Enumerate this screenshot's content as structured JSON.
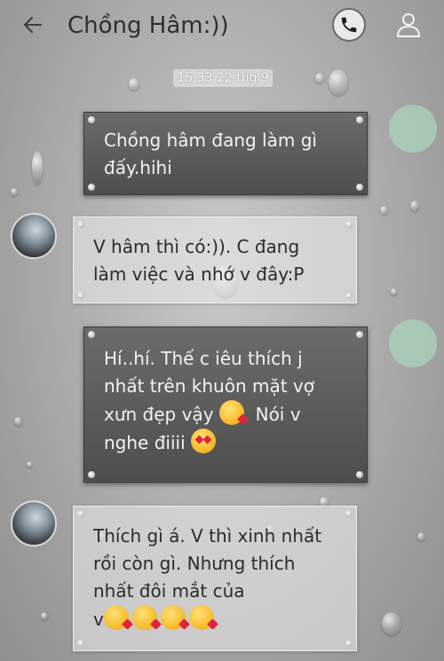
{
  "header": {
    "back_icon": "arrow-left-icon",
    "title": "Chồng Hâm:))",
    "call_icon": "phone-icon",
    "profile_icon": "user-icon"
  },
  "timestamp": "15:33 22 thg 9",
  "messages": [
    {
      "direction": "outgoing",
      "lines": [
        "Chồng hâm đang làm gì",
        "đấy.hihi"
      ],
      "emojis": []
    },
    {
      "direction": "incoming",
      "lines": [
        "V hâm thì có:)). C đang",
        "làm việc và nhớ v đây:P"
      ],
      "emojis": []
    },
    {
      "direction": "outgoing",
      "lines": [
        "Hí..hí. Thế c iêu thích j",
        "nhất trên khuôn mặt vợ",
        "xưn đẹp vậy",
        ". Nói v",
        "nghe điiii"
      ],
      "emojis": [
        "face-blowing-kiss",
        "heart-eyes"
      ]
    },
    {
      "direction": "incoming",
      "lines": [
        "Thích gì á. V thì xinh nhất",
        "rồi còn gì. Nhưng thích",
        "nhất đôi mắt của",
        "v"
      ],
      "emojis": [
        "face-blowing-kiss",
        "face-blowing-kiss",
        "face-blowing-kiss",
        "face-blowing-kiss"
      ]
    }
  ],
  "colors": {
    "outgoing_bubble": "#5a5a5a",
    "incoming_bubble": "#e8e8e8",
    "seen_indicator": "#aadcbe"
  }
}
